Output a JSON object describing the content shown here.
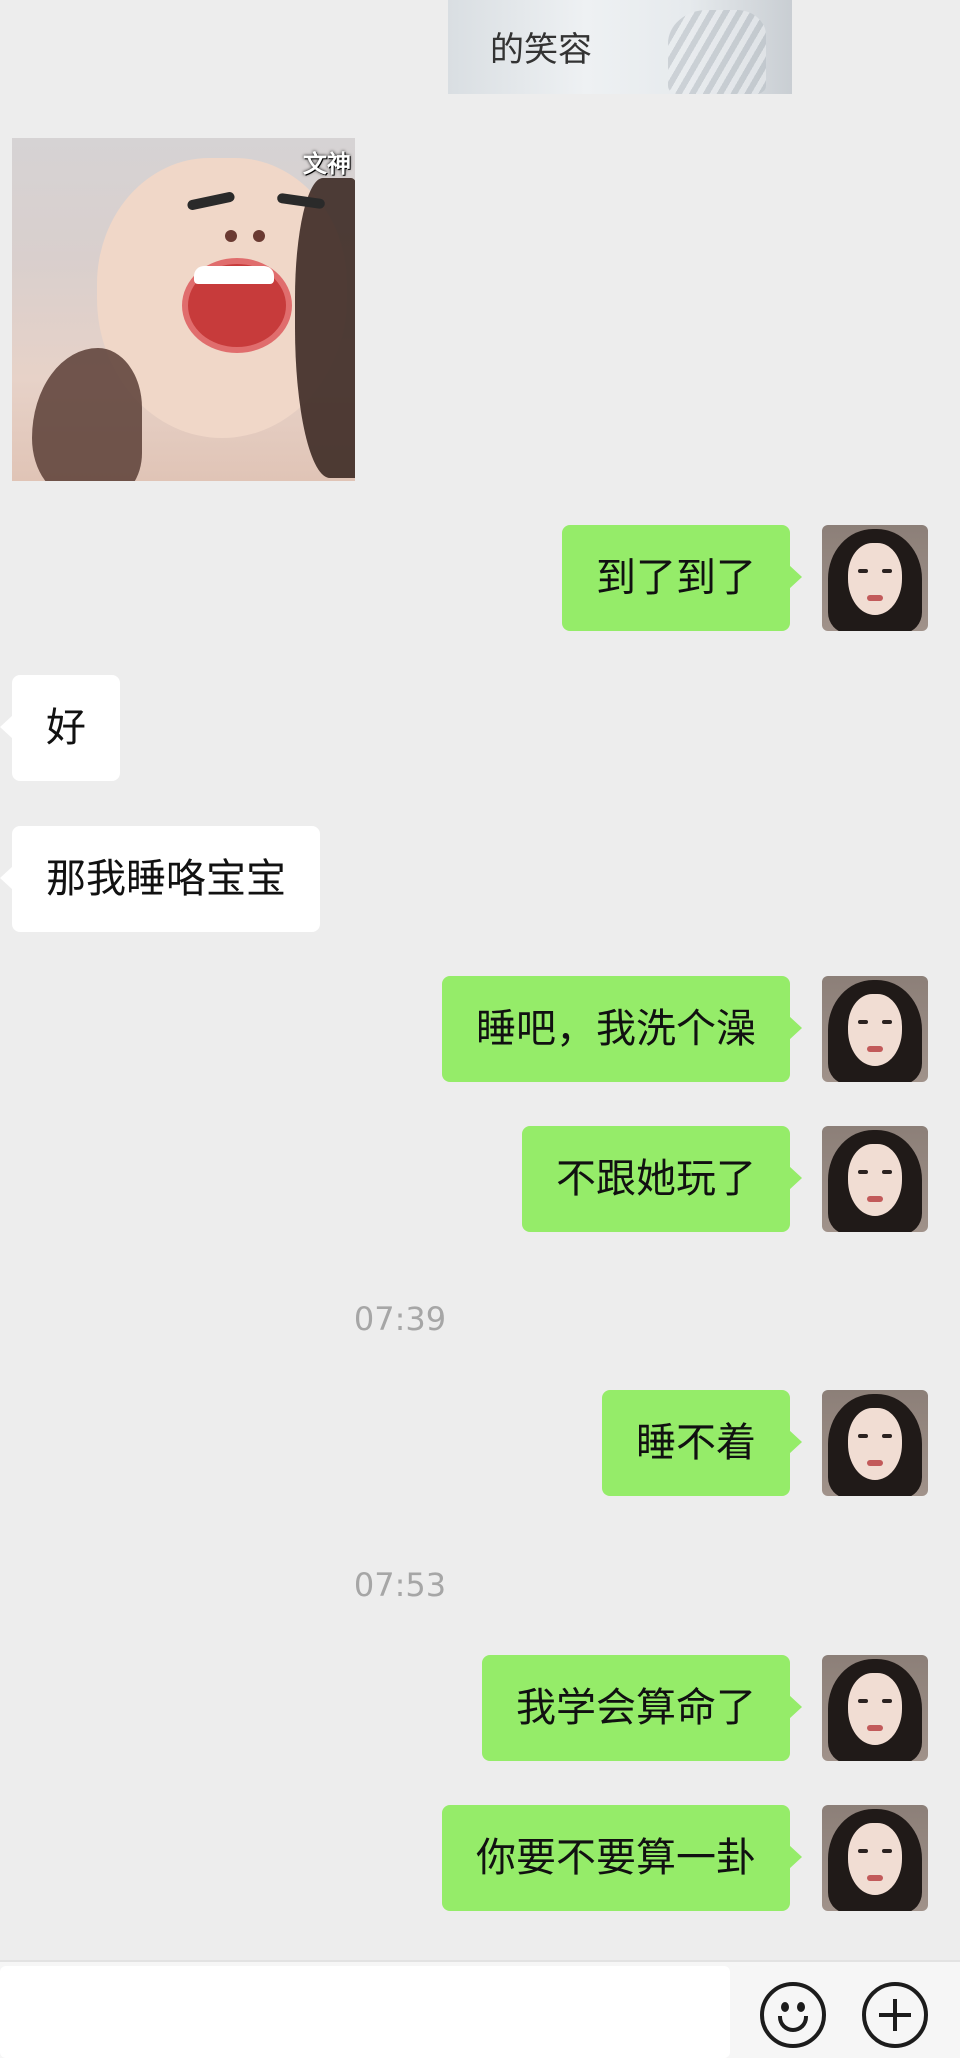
{
  "sticker_caption": "的笑容",
  "image_watermark": "文神",
  "messages": [
    {
      "text": "到了到了"
    },
    {
      "text": "好"
    },
    {
      "text": "那我睡咯宝宝"
    },
    {
      "text": "睡吧，我洗个澡"
    },
    {
      "text": "不跟她玩了"
    },
    {
      "text": "睡不着"
    },
    {
      "text": "我学会算命了"
    },
    {
      "text": "你要不要算一卦"
    }
  ],
  "timestamps": [
    "07:39",
    "07:53"
  ],
  "input": {
    "value": ""
  },
  "colors": {
    "background": "#ededed",
    "my_bubble": "#95ec69",
    "their_bubble": "#ffffff",
    "timestamp": "#a6a6a6"
  }
}
